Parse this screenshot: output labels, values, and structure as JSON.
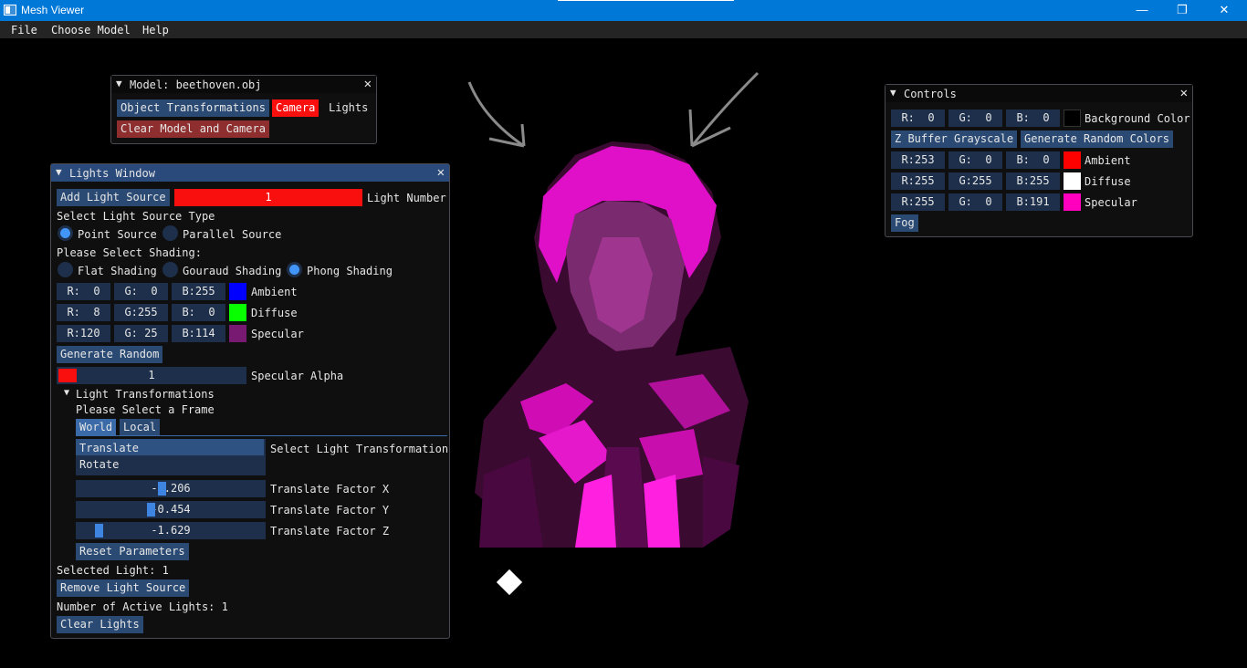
{
  "window": {
    "title": "Mesh Viewer",
    "minimize": "—",
    "maximize": "❐",
    "close": "✕"
  },
  "menu": {
    "items": [
      "File",
      "Choose Model",
      "Help"
    ]
  },
  "model_window": {
    "title": "Model: beethoven.obj",
    "arrow": "▼",
    "close": "✕",
    "tabs": [
      "Object Transformations",
      "Camera",
      "Lights"
    ],
    "clear_button": "Clear Model and Camera"
  },
  "lights_window": {
    "title": "Lights Window",
    "arrow": "▼",
    "close": "✕",
    "add_button": "Add Light Source",
    "light_number_value": "1",
    "light_number_label": "Light Number",
    "source_type_label": "Select Light Source Type",
    "source_types": [
      "Point Source",
      "Parallel Source"
    ],
    "shading_label": "Please Select Shading:",
    "shadings": [
      "Flat Shading",
      "Gouraud Shading",
      "Phong Shading"
    ],
    "ambient": {
      "r": "R:  0",
      "g": "G:  0",
      "b": "B:255",
      "label": "Ambient",
      "color": "#0000ff"
    },
    "diffuse": {
      "r": "R:  8",
      "g": "G:255",
      "b": "B:  0",
      "label": "Diffuse",
      "color": "#08ff00"
    },
    "specular": {
      "r": "R:120",
      "g": "G: 25",
      "b": "B:114",
      "label": "Specular",
      "color": "#781972"
    },
    "generate_random": "Generate Random",
    "specular_alpha_value": "1",
    "specular_alpha_label": "Specular Alpha",
    "transformations_header": "Light Transformations",
    "tree_arrow": "▼",
    "frame_label": "Please Select a Frame",
    "frames": [
      "World",
      "Local"
    ],
    "transform_list": [
      "Translate",
      "Rotate"
    ],
    "transform_label": "Select Light Transformation",
    "translate_x": {
      "value": "-0.206",
      "label": "Translate Factor X"
    },
    "translate_y": {
      "value": "-0.454",
      "label": "Translate Factor Y"
    },
    "translate_z": {
      "value": "-1.629",
      "label": "Translate Factor Z"
    },
    "reset_button": "Reset Parameters",
    "selected_light": "Selected Light: 1",
    "remove_button": "Remove Light Source",
    "active_lights": "Number of Active Lights: 1",
    "clear_button": "Clear Lights"
  },
  "controls_window": {
    "title": "Controls",
    "arrow": "▼",
    "close": "✕",
    "background": {
      "r": "R:  0",
      "g": "G:  0",
      "b": "B:  0",
      "label": "Background Color",
      "color": "#000000"
    },
    "zbuffer_button": "Z Buffer Grayscale",
    "random_colors_button": "Generate Random Colors",
    "ambient": {
      "r": "R:253",
      "g": "G:  0",
      "b": "B:  0",
      "label": "Ambient",
      "color": "#fd0000"
    },
    "diffuse": {
      "r": "R:255",
      "g": "G:255",
      "b": "B:255",
      "label": "Diffuse",
      "color": "#ffffff"
    },
    "specular": {
      "r": "R:255",
      "g": "G:  0",
      "b": "B:191",
      "label": "Specular",
      "color": "#ff00bf"
    },
    "fog_button": "Fog"
  }
}
